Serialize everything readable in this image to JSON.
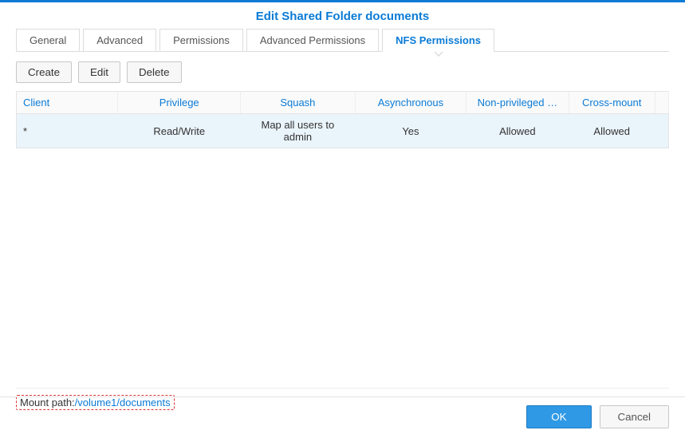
{
  "title": "Edit Shared Folder documents",
  "tabs": {
    "general": "General",
    "advanced": "Advanced",
    "permissions": "Permissions",
    "adv_permissions": "Advanced Permissions",
    "nfs_permissions": "NFS Permissions"
  },
  "toolbar": {
    "create": "Create",
    "edit": "Edit",
    "delete": "Delete"
  },
  "columns": {
    "client": "Client",
    "privilege": "Privilege",
    "squash": "Squash",
    "async": "Asynchronous",
    "nonpriv": "Non-privileged …",
    "cross": "Cross-mount"
  },
  "rows": [
    {
      "client": "*",
      "privilege": "Read/Write",
      "squash": "Map all users to admin",
      "async": "Yes",
      "nonpriv": "Allowed",
      "cross": "Allowed"
    }
  ],
  "mount": {
    "label": "Mount path:",
    "path": "/volume1/documents"
  },
  "footer": {
    "ok": "OK",
    "cancel": "Cancel"
  }
}
